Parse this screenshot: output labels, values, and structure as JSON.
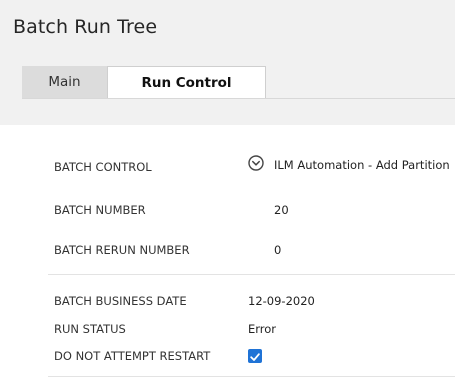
{
  "page": {
    "title": "Batch Run Tree"
  },
  "tabs": [
    {
      "label": "Main",
      "selected": false
    },
    {
      "label": "Run Control",
      "selected": true
    }
  ],
  "fields": {
    "batch_control": {
      "label": "BATCH CONTROL",
      "value": "ILM Automation - Add Partition"
    },
    "batch_number": {
      "label": "BATCH NUMBER",
      "value": "20"
    },
    "batch_rerun_number": {
      "label": "BATCH RERUN NUMBER",
      "value": "0"
    },
    "batch_business_date": {
      "label": "BATCH BUSINESS DATE",
      "value": "12-09-2020"
    },
    "run_status": {
      "label": "RUN STATUS",
      "value": "Error"
    },
    "do_not_attempt_restart": {
      "label": "DO NOT ATTEMPT RESTART",
      "checked": true
    }
  },
  "icons": {
    "batch_control_expand": "chevron-down-circle-icon",
    "checkbox": "check-icon"
  },
  "colors": {
    "checkbox": "#1f73d6",
    "header_bg": "#f1f1f1",
    "tab_main_bg": "#dcdcdc"
  }
}
